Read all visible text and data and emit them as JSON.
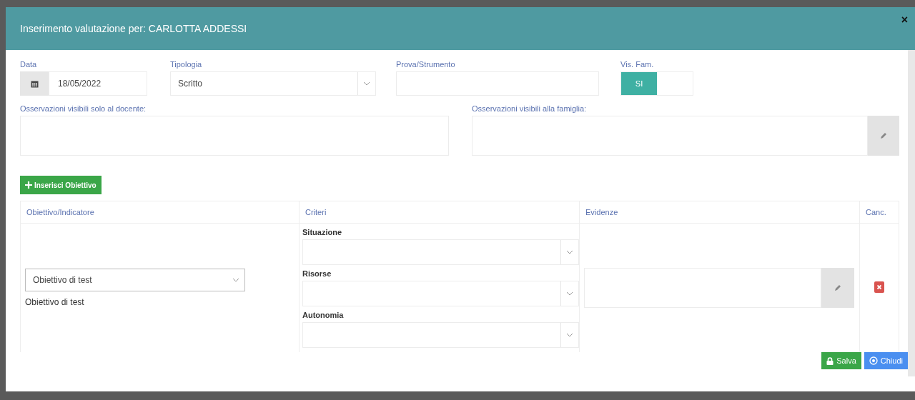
{
  "modal": {
    "title": "Inserimento valutazione per: CARLOTTA ADDESSI",
    "close": "×"
  },
  "form": {
    "data": {
      "label": "Data",
      "value": "18/05/2022"
    },
    "tipologia": {
      "label": "Tipologia",
      "value": "Scritto"
    },
    "prova": {
      "label": "Prova/Strumento"
    },
    "vis_fam": {
      "label": "Vis. Fam.",
      "on": true,
      "on_text": "SI"
    },
    "oss_docente": {
      "label": "Osservazioni visibili solo al docente:"
    },
    "oss_famiglia": {
      "label": "Osservazioni visibili alla famiglia:"
    }
  },
  "add_button": "Inserisci Obiettivo",
  "table": {
    "columns": [
      "Obiettivo/Indicatore",
      "Criteri",
      "Evidenze",
      "Canc."
    ],
    "rows": [
      {
        "obiettivo_select": "Obiettivo di test",
        "obiettivo_text": "Obiettivo di test",
        "criteri": [
          {
            "label": "Situazione"
          },
          {
            "label": "Risorse"
          },
          {
            "label": "Autonomia"
          }
        ]
      }
    ]
  },
  "footer": {
    "save": "Salva",
    "close": "Chiudi"
  }
}
